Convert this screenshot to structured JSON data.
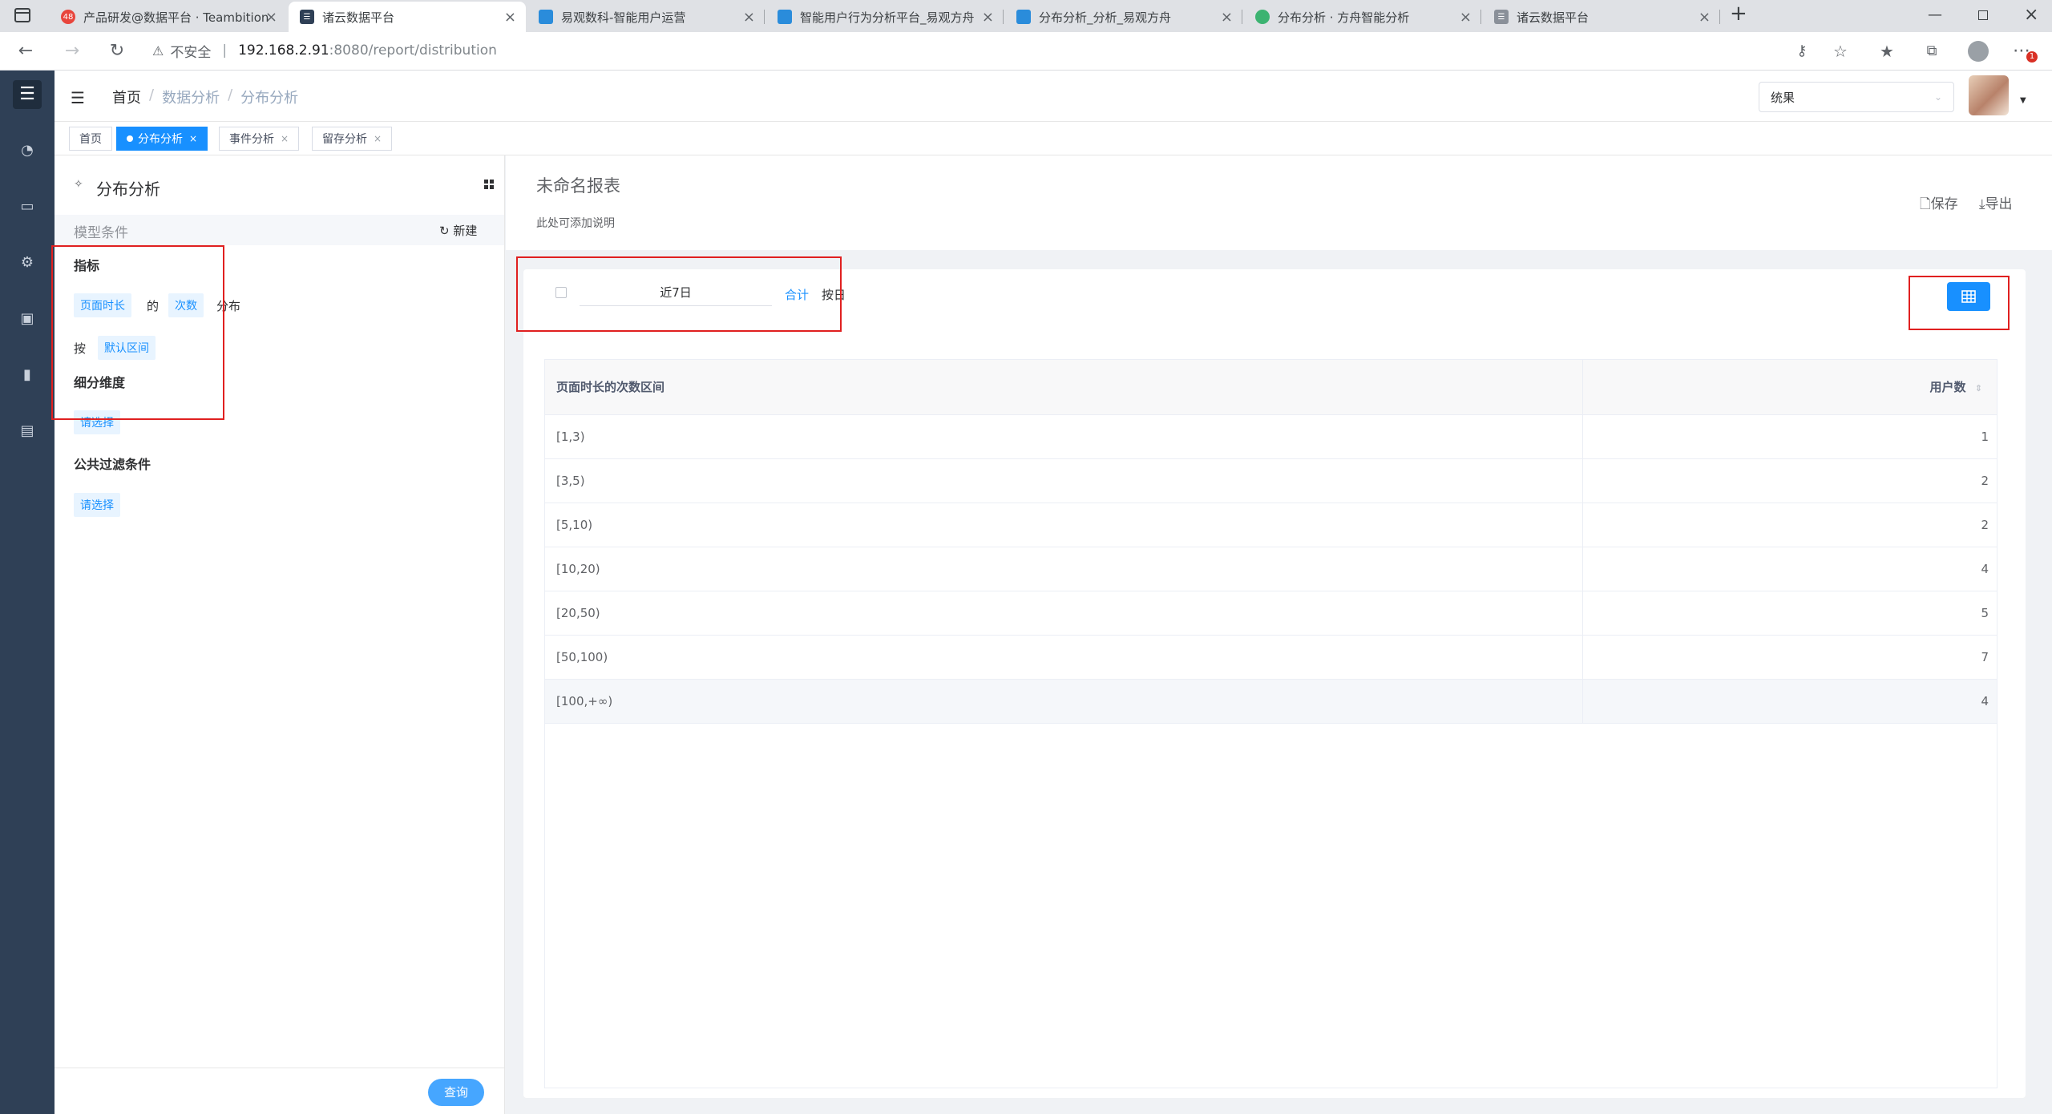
{
  "browser": {
    "tabs": [
      {
        "title": "产品研发@数据平台 · Teambition",
        "badge": "48",
        "icon_color": "#e8453c",
        "active": false
      },
      {
        "title": "诸云数据平台",
        "icon_color": "#2f4056",
        "active": true
      },
      {
        "title": "易观数科-智能用户运营",
        "icon_color": "#2a8cdb",
        "active": false
      },
      {
        "title": "智能用户行为分析平台_易观方舟",
        "icon_color": "#2a8cdb",
        "active": false
      },
      {
        "title": "分布分析_分析_易观方舟",
        "icon_color": "#2a8cdb",
        "active": false
      },
      {
        "title": "分布分析 · 方舟智能分析",
        "icon_color": "#3cb371",
        "active": false
      },
      {
        "title": "诸云数据平台",
        "icon_color": "#8a9099",
        "active": false
      }
    ],
    "new_tab": "+",
    "security_label": "不安全",
    "url_host": "192.168.2.91",
    "url_path": ":8080/report/distribution",
    "notification_badge": "1"
  },
  "header": {
    "breadcrumb": [
      "首页",
      "数据分析",
      "分布分析"
    ],
    "separator": "/",
    "company_select": "统果"
  },
  "tags": [
    {
      "label": "首页",
      "active": false,
      "closable": false
    },
    {
      "label": "分布分析",
      "active": true,
      "closable": true
    },
    {
      "label": "事件分析",
      "active": false,
      "closable": true
    },
    {
      "label": "留存分析",
      "active": false,
      "closable": true
    }
  ],
  "left": {
    "title": "分布分析",
    "model_conditions": "模型条件",
    "new_label": "新建",
    "metric_heading": "指标",
    "metric_field": "页面时长",
    "of_label": "的",
    "metric_measure": "次数",
    "distribution_label": "分布",
    "by_label": "按",
    "interval": "默认区间",
    "dimension_heading": "细分维度",
    "dimension_select": "请选择",
    "filter_heading": "公共过滤条件",
    "filter_select": "请选择",
    "query_button": "查询"
  },
  "report": {
    "title": "未命名报表",
    "description": "此处可添加说明",
    "save": "保存",
    "export": "导出",
    "date_range": "近7日",
    "total_label": "合计",
    "by_day_label": "按日"
  },
  "table": {
    "columns": [
      "页面时长的次数区间",
      "用户数"
    ],
    "rows": [
      {
        "interval": "[1,3)",
        "users": "1"
      },
      {
        "interval": "[3,5)",
        "users": "2"
      },
      {
        "interval": "[5,10)",
        "users": "2"
      },
      {
        "interval": "[10,20)",
        "users": "4"
      },
      {
        "interval": "[20,50)",
        "users": "5"
      },
      {
        "interval": "[50,100)",
        "users": "7"
      },
      {
        "interval": "[100,+∞)",
        "users": "4"
      }
    ]
  },
  "colors": {
    "primary": "#1890ff",
    "sidebar": "#2f4056",
    "highlight": "#e02020"
  }
}
